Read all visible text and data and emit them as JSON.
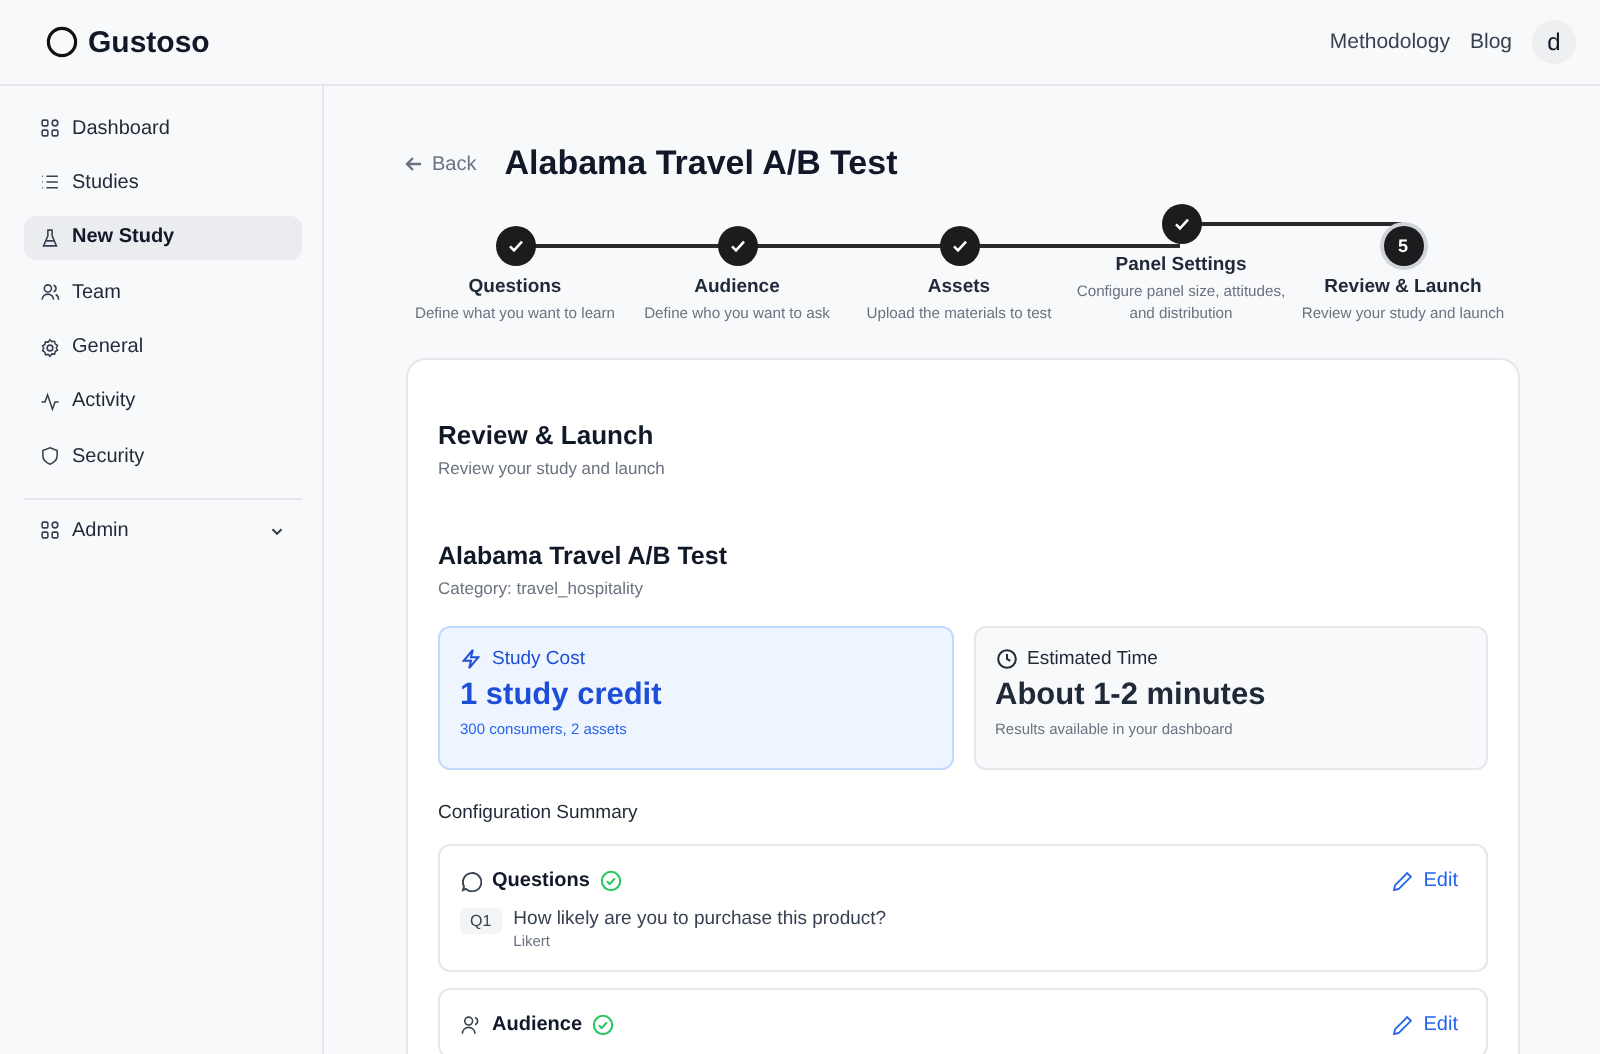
{
  "header": {
    "brand": "Gustoso",
    "links": [
      "Methodology",
      "Blog"
    ],
    "avatar": "d"
  },
  "sidebar": {
    "items": [
      {
        "label": "Dashboard",
        "selected": false
      },
      {
        "label": "Studies",
        "selected": false
      },
      {
        "label": "New Study",
        "selected": true
      },
      {
        "label": "Team",
        "selected": false
      },
      {
        "label": "General",
        "selected": false
      },
      {
        "label": "Activity",
        "selected": false
      },
      {
        "label": "Security",
        "selected": false
      }
    ],
    "admin": {
      "label": "Admin",
      "expanded": false
    }
  },
  "page": {
    "back": "Back",
    "title": "Alabama Travel A/B Test"
  },
  "steps": [
    {
      "label": "Questions",
      "description": "Define what you want to learn",
      "completed": true
    },
    {
      "label": "Audience",
      "description": "Define who you want to ask",
      "completed": true
    },
    {
      "label": "Assets",
      "description": "Upload the materials to test",
      "completed": true
    },
    {
      "label": "Panel Settings",
      "description": "Configure panel size, attitudes, and distribution",
      "completed": true
    },
    {
      "label": "Review & Launch",
      "description": "Review your study and launch",
      "completed": false,
      "number": "5"
    }
  ],
  "review": {
    "heading": "Review & Launch",
    "subheading": "Review your study and launch",
    "study_name": "Alabama Travel A/B Test",
    "category": "Category: travel_hospitality",
    "stats": [
      {
        "kind": "cost",
        "label": "Study Cost",
        "value": "1 study credit",
        "note": "300 consumers, 2 assets"
      },
      {
        "kind": "time",
        "label": "Estimated Time",
        "value": "About 1-2 minutes",
        "note": "Results available in your dashboard"
      }
    ],
    "summary_title": "Configuration Summary",
    "sections": [
      {
        "kind": "questions",
        "title": "Questions",
        "complete": true,
        "edit": "Edit",
        "items": [
          {
            "tag": "Q1",
            "text": "How likely are you to purchase this product?",
            "type": "Likert"
          }
        ]
      },
      {
        "kind": "audience",
        "title": "Audience",
        "complete": true,
        "edit": "Edit"
      }
    ]
  }
}
